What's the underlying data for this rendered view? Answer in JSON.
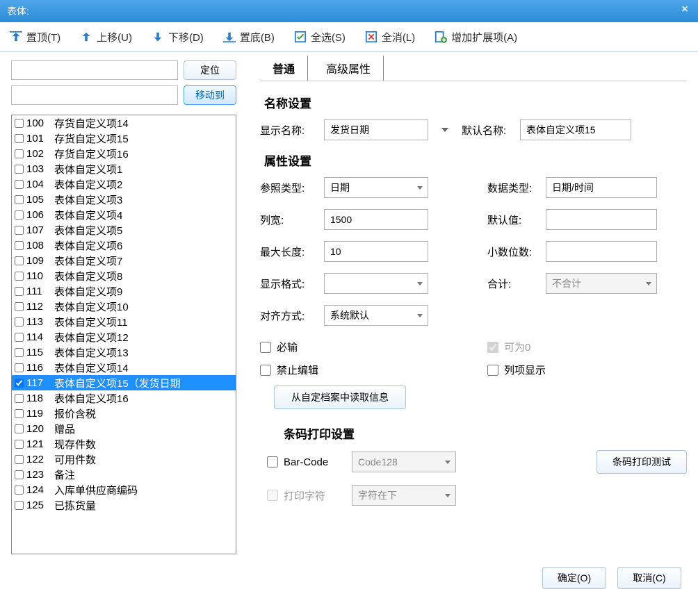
{
  "title": "表体:",
  "toolbar": {
    "top": "置顶(T)",
    "up": "上移(U)",
    "down": "下移(D)",
    "bottom": "置底(B)",
    "selectAll": "全选(S)",
    "deselectAll": "全消(L)",
    "addExt": "增加扩展项(A)"
  },
  "left": {
    "locate": "定位",
    "moveTo": "移动到"
  },
  "items": [
    {
      "idx": "100",
      "label": "存货自定义项14",
      "checked": false
    },
    {
      "idx": "101",
      "label": "存货自定义项15",
      "checked": false
    },
    {
      "idx": "102",
      "label": "存货自定义项16",
      "checked": false
    },
    {
      "idx": "103",
      "label": "表体自定义项1",
      "checked": false
    },
    {
      "idx": "104",
      "label": "表体自定义项2",
      "checked": false
    },
    {
      "idx": "105",
      "label": "表体自定义项3",
      "checked": false
    },
    {
      "idx": "106",
      "label": "表体自定义项4",
      "checked": false
    },
    {
      "idx": "107",
      "label": "表体自定义项5",
      "checked": false
    },
    {
      "idx": "108",
      "label": "表体自定义项6",
      "checked": false
    },
    {
      "idx": "109",
      "label": "表体自定义项7",
      "checked": false
    },
    {
      "idx": "110",
      "label": "表体自定义项8",
      "checked": false
    },
    {
      "idx": "111",
      "label": "表体自定义项9",
      "checked": false
    },
    {
      "idx": "112",
      "label": "表体自定义项10",
      "checked": false
    },
    {
      "idx": "113",
      "label": "表体自定义项11",
      "checked": false
    },
    {
      "idx": "114",
      "label": "表体自定义项12",
      "checked": false
    },
    {
      "idx": "115",
      "label": "表体自定义项13",
      "checked": false
    },
    {
      "idx": "116",
      "label": "表体自定义项14",
      "checked": false
    },
    {
      "idx": "117",
      "label": "表体自定义项15（发货日期",
      "checked": true,
      "selected": true
    },
    {
      "idx": "118",
      "label": "表体自定义项16",
      "checked": false
    },
    {
      "idx": "119",
      "label": "报价含税",
      "checked": false
    },
    {
      "idx": "120",
      "label": "赠品",
      "checked": false
    },
    {
      "idx": "121",
      "label": "现存件数",
      "checked": false
    },
    {
      "idx": "122",
      "label": "可用件数",
      "checked": false
    },
    {
      "idx": "123",
      "label": "备注",
      "checked": false
    },
    {
      "idx": "124",
      "label": "入库单供应商编码",
      "checked": false
    },
    {
      "idx": "125",
      "label": "已拣货量",
      "checked": false
    }
  ],
  "tabs": {
    "general": "普通",
    "advanced": "高级属性"
  },
  "sections": {
    "name": "名称设置",
    "attr": "属性设置",
    "barcode": "条码打印设置"
  },
  "labels": {
    "displayName": "显示名称:",
    "defaultName": "默认名称:",
    "refType": "参照类型:",
    "dataType": "数据类型:",
    "colWidth": "列宽:",
    "defaultVal": "默认值:",
    "maxLen": "最大长度:",
    "decimals": "小数位数:",
    "format": "显示格式:",
    "total": "合计:",
    "align": "对齐方式:",
    "required": "必输",
    "allowZero": "可为0",
    "noEdit": "禁止编辑",
    "colShow": "列项显示",
    "readFromArchive": "从自定档案中读取信息",
    "barcode": "Bar-Code",
    "printChar": "打印字符",
    "barcodeTest": "条码打印测试"
  },
  "values": {
    "displayName": "发货日期",
    "defaultName": "表体自定义项15",
    "refType": "日期",
    "dataType": "日期/时间",
    "colWidth": "1500",
    "defaultVal": "",
    "maxLen": "10",
    "decimals": "",
    "format": "",
    "total": "不合计",
    "align": "系统默认",
    "barcodeType": "Code128",
    "printCharPos": "字符在下"
  },
  "footer": {
    "ok": "确定(O)",
    "cancel": "取消(C)"
  }
}
